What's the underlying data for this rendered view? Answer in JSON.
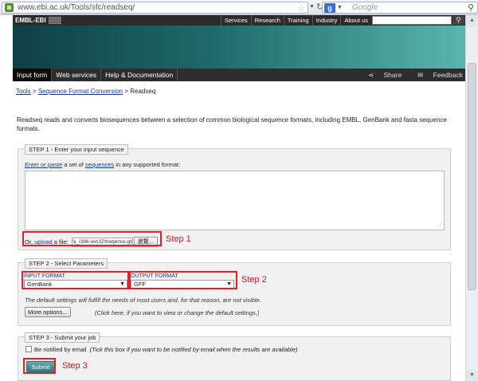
{
  "browser": {
    "url": "www.ebi.ac.uk/Tools/sfc/readseq/",
    "search_placeholder": "Google",
    "search_engine_letter": "g"
  },
  "header": {
    "logo": "EMBL-EBI",
    "nav": [
      "Services",
      "Research",
      "Training",
      "Industry",
      "About us"
    ]
  },
  "subnav": {
    "tabs": [
      "Input form",
      "Web services",
      "Help & Documentation"
    ],
    "share": "Share",
    "feedback": "Feedback"
  },
  "breadcrumb": {
    "tools": "Tools",
    "sep1": ">",
    "sfc": "Sequence Format Conversion",
    "sep2": ">",
    "current": "Readseq"
  },
  "intro": "Readseq reads and converts biosequences between a selection of common biological sequence formats, including EMBL, GenBank and fasta sequence formats.",
  "step1": {
    "legend": "STEP 1 - Enter your input sequence",
    "enter_or_paste": "Enter or paste",
    "a_set_of": "a set of",
    "sequences": "sequences",
    "suffix": "in any supported format:",
    "or": "Or,",
    "upload": "upload",
    "a_file": "a file:",
    "file_value": "'a_i386-win32\\treqence.gb",
    "browse": "瀏覽..."
  },
  "step2": {
    "legend": "STEP 2 - Select Parameters",
    "input_label": "INPUT FORMAT",
    "input_value": "GenBank",
    "output_label": "OUTPUT FORMAT",
    "output_value": "GFF",
    "default_note": "The default settings will fulfill the needs of most users and, for that reason, are not visible.",
    "more_options": "More options...",
    "more_hint": "(Click here, if you want to view or change the default settings.)"
  },
  "step3": {
    "legend": "STEP 3 - Submit your job",
    "notify_label": "Be notified by email",
    "notify_hint": "(Tick this box if you want to be notified by email when the results are available)",
    "submit": "Submit"
  },
  "annotations": {
    "step1": "Step 1",
    "step2": "Step 2",
    "step3": "Step 3",
    "color": "#e1212d"
  }
}
